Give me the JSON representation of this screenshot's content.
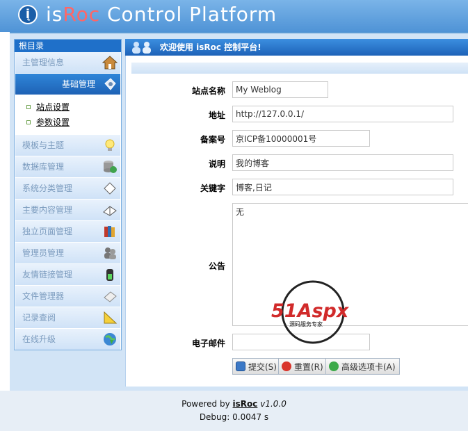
{
  "header": {
    "logo_glyph": "į",
    "title_pre": "is",
    "title_hl": "Roc",
    "title_post": " Control Platform"
  },
  "sidebar": {
    "title": "根目录",
    "items": [
      {
        "label": "主管理信息",
        "icon": "house-icon"
      },
      {
        "label": "基础管理",
        "icon": "gear-puzzle-icon",
        "active": true
      }
    ],
    "sub_links": [
      {
        "label": "站点设置"
      },
      {
        "label": "参数设置"
      }
    ],
    "items2": [
      {
        "label": "模板与主题",
        "icon": "lightbulb-icon"
      },
      {
        "label": "数据库管理",
        "icon": "database-icon"
      },
      {
        "label": "系统分类管理",
        "icon": "tag-icon"
      },
      {
        "label": "主要内容管理",
        "icon": "book-icon"
      },
      {
        "label": "独立页面管理",
        "icon": "books-icon"
      },
      {
        "label": "管理员管理",
        "icon": "users-icon"
      },
      {
        "label": "友情链接管理",
        "icon": "battery-icon"
      },
      {
        "label": "文件管理器",
        "icon": "file-icon"
      },
      {
        "label": "记录查阅",
        "icon": "ruler-icon"
      },
      {
        "label": "在线升级",
        "icon": "globe-icon"
      }
    ]
  },
  "content": {
    "welcome": "欢迎使用 isRoc 控制平台!",
    "fields": {
      "site_name": {
        "label": "站点名称",
        "value": "My Weblog"
      },
      "address": {
        "label": "地址",
        "value": "http://127.0.0.1/"
      },
      "icp": {
        "label": "备案号",
        "value": "京ICP备10000001号"
      },
      "description": {
        "label": "说明",
        "value": "我的博客"
      },
      "keywords": {
        "label": "关键字",
        "value": "博客,日记"
      },
      "notice": {
        "label": "公告",
        "value": "无"
      },
      "email": {
        "label": "电子邮件",
        "value": ""
      }
    },
    "buttons": {
      "submit": "提交(S)",
      "reset": "重置(R)",
      "advanced": "高级选项卡(A)"
    }
  },
  "watermark": {
    "brand": "51Aspx",
    "tagline": "源码服务专家"
  },
  "footer": {
    "powered_by": "Powered by",
    "brand": "isRoc",
    "version": "v1.0.0",
    "debug": "Debug: 0.0047 s"
  },
  "colors": {
    "header_bg": "#5a9bd5",
    "accent": "#1f70c9",
    "highlight": "#ff6666"
  }
}
